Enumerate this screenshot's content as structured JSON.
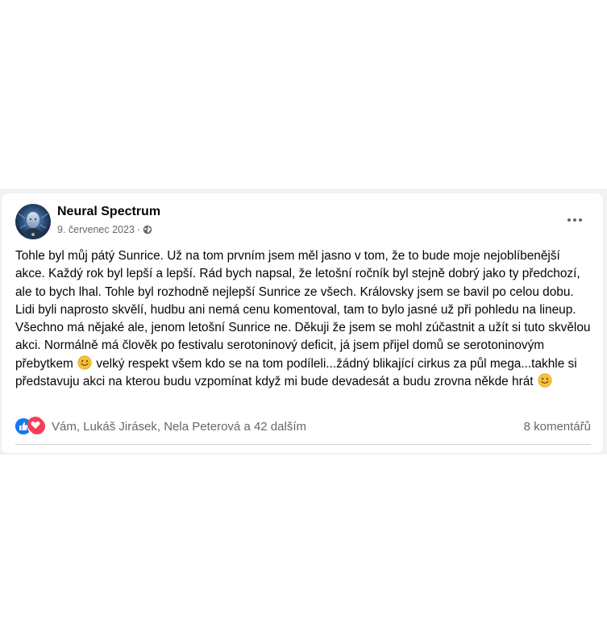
{
  "post": {
    "author": "Neural Spectrum",
    "date": "9. červenec 2023",
    "meta_separator": "·",
    "audience_icon": "globe-icon",
    "more_icon": "more-horizontal-icon",
    "paragraph": {
      "part1": "Tohle byl můj pátý Sunrice. Už na tom prvním jsem měl jasno v tom, že to bude moje nejoblíbenější akce. Každý rok byl lepší a lepší. Rád bych napsal, že letošní ročník byl stejně dobrý jako ty předchozí, ale to bych lhal. Tohle byl rozhodně nejlepší Sunrice ze všech. Královsky jsem se bavil po celou dobu. Lidi byli naprosto skvělí, hudbu ani nemá cenu komentoval, tam to bylo jasné už při pohledu na lineup. Všechno má nějaké ale, jenom letošní Sunrice ne. Děkuji že jsem se mohl zúčastnit a užít si tuto skvělou akci. Normálně má člověk po festivalu serotoninový deficit, já jsem přijel domů se serotoninovým přebytkem",
      "part2": " velký respekt všem kdo se na tom podíleli...žádný blikající cirkus za půl mega...takhle si představuju akci na kterou budu vzpomínat když mi bude devadesát a budu zrovna někde hrát",
      "emoji_icon": "smiling-face-emoji-icon"
    }
  },
  "reactions": {
    "icons": [
      "like-reaction-icon",
      "love-reaction-icon"
    ],
    "summary": "Vám, Lukáš Jirásek, Nela Peterová a 42 dalším",
    "comments": "8 komentářů"
  },
  "colors": {
    "like": "#1877f2",
    "love": "#f33e58",
    "secondary_text": "#65676b",
    "primary_text": "#050505",
    "feed_background": "#f0f2f5",
    "divider": "#ced0d4"
  }
}
